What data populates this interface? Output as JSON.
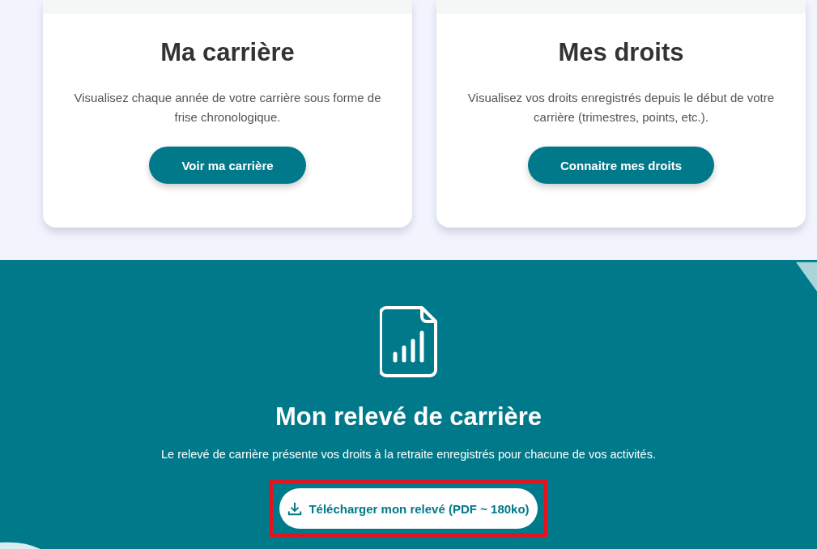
{
  "cards": [
    {
      "title": "Ma carrière",
      "description": "Visualisez chaque année de votre carrière sous forme de frise chronologique.",
      "button": "Voir ma carrière"
    },
    {
      "title": "Mes droits",
      "description": "Visualisez vos droits enregistrés depuis le début de votre carrière (trimestres, points, etc.).",
      "button": "Connaitre mes droits"
    }
  ],
  "statement": {
    "title": "Mon relevé de carrière",
    "description": "Le relevé de carrière présente vos droits à la retraite enregistrés pour chacune de vos activités.",
    "button": {
      "label": "Télécharger mon relevé (PDF ~ 180ko)",
      "highlighted": true
    }
  }
}
